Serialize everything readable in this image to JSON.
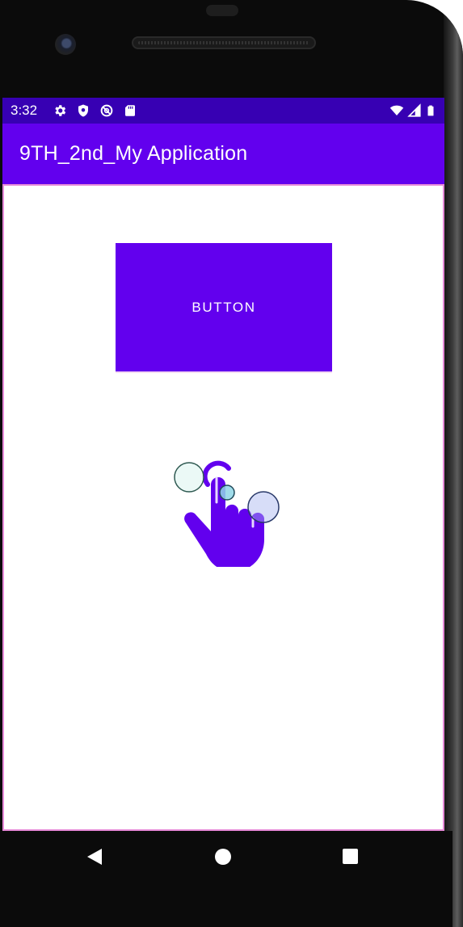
{
  "status_bar": {
    "time": "3:32",
    "icons_left": [
      "gear-icon",
      "shield-icon",
      "no-sync-icon",
      "sd-card-icon"
    ],
    "icons_right": [
      "wifi-icon",
      "cell-signal-icon",
      "battery-icon"
    ]
  },
  "app_bar": {
    "title": "9TH_2nd_My Application"
  },
  "main": {
    "button_label": "BUTTON",
    "touch_gesture_icon": "tap-gesture-icon"
  },
  "nav_bar": {
    "icons": [
      "back-icon",
      "home-icon",
      "recents-icon"
    ]
  },
  "colors": {
    "status_bar": "#3700B3",
    "app_bar": "#6200EE",
    "button": "#6200EE",
    "content_border": "#E68AD8"
  }
}
